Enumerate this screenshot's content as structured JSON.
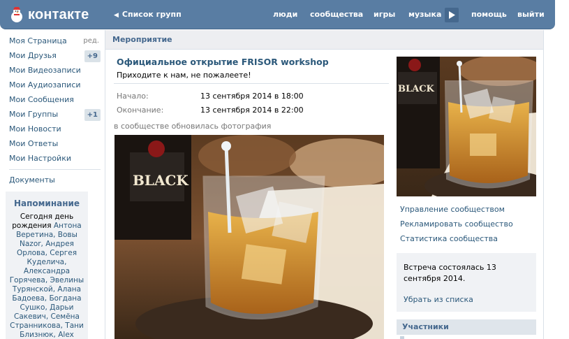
{
  "header": {
    "logo_text": "контакте",
    "back_link": "Список групп",
    "nav": [
      "люди",
      "сообщества",
      "игры",
      "музыка",
      "помощь",
      "выйти"
    ],
    "logo_icon": "snowman-logo-icon",
    "more_icon": "play-right-icon"
  },
  "menu": {
    "items": [
      {
        "label": "Моя Страница",
        "extra": "ред."
      },
      {
        "label": "Мои Друзья",
        "badge": "+9"
      },
      {
        "label": "Мои Видеозаписи"
      },
      {
        "label": "Мои Аудиозаписи"
      },
      {
        "label": "Мои Сообщения"
      },
      {
        "label": "Мои Группы",
        "badge": "+1"
      },
      {
        "label": "Мои Новости"
      },
      {
        "label": "Мои Ответы"
      },
      {
        "label": "Мои Настройки"
      }
    ],
    "documents": "Документы"
  },
  "reminder": {
    "title": "Напоминание",
    "lines": [
      {
        "text": "Сегодня ",
        "link": false
      },
      {
        "text": "день рождения",
        "link": false,
        "bold": true
      },
      {
        "text": " Антона Веретина, Вовы Nazor, Андрея Орлова, Сергея Куделича, Александра Горячева, Эвелины Турянской, Алана Бадоева, Богдана Сушко, Дарьи Сакевич, Семёна Странникова, Тани Близнюк, Alex",
        "link": true
      }
    ]
  },
  "main": {
    "section_title": "Мероприятие",
    "event_title": "Официальное открытие FRISOR workshop",
    "event_desc": "Приходите к нам, не пожалеете!",
    "start_label": "Начало:",
    "start_value": "13 сентября 2014 в 18:00",
    "end_label": "Окончание:",
    "end_value": "13 сентября 2014 в 22:00",
    "post_note": "в сообществе обновилась фотография"
  },
  "side": {
    "links": [
      "Управление сообществом",
      "Рекламировать сообщество",
      "Статистика сообщества"
    ],
    "notice_text": "Встреча состоялась 13 сентября 2014.",
    "notice_link": "Убрать из списка",
    "members_title": "Участники"
  },
  "photo": {
    "bottle_label": "BLACK"
  },
  "colors": {
    "header": "#597da3",
    "link": "#2b587a",
    "accent": "#45688e"
  }
}
